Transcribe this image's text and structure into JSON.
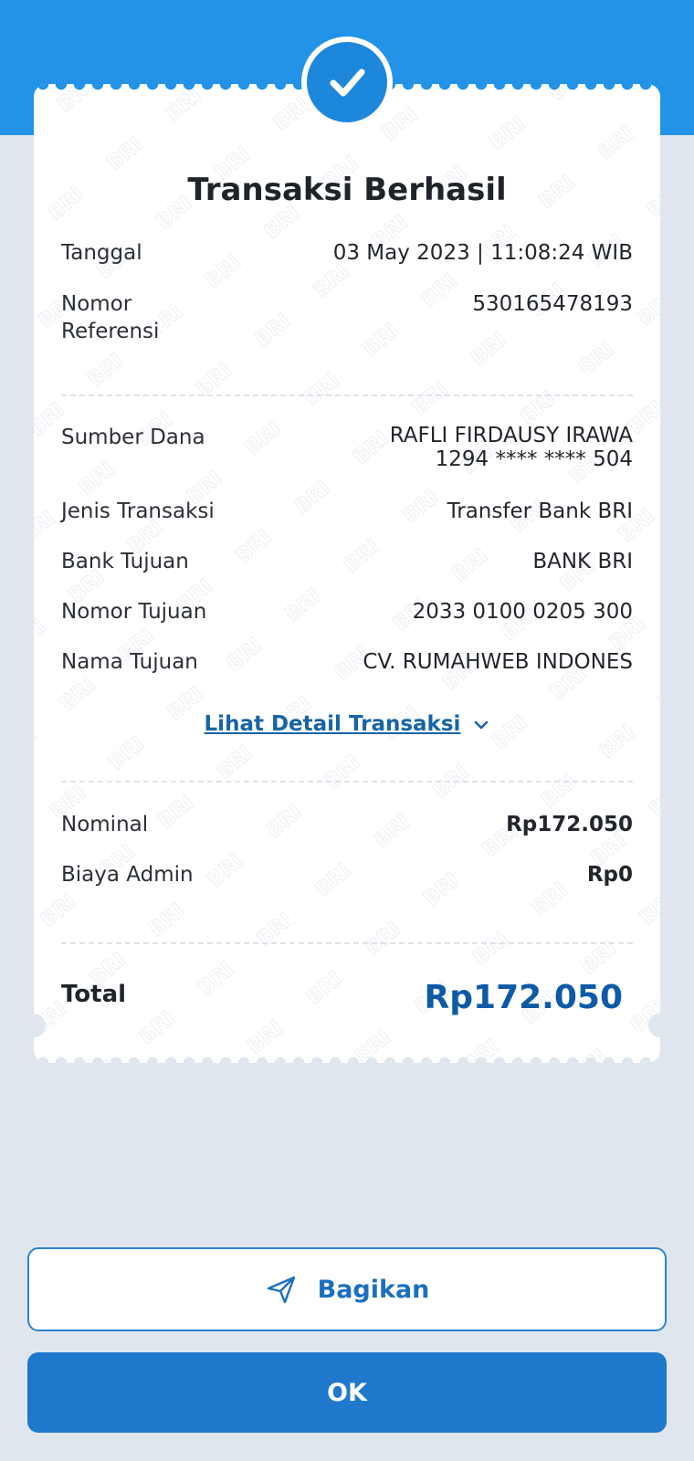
{
  "colors": {
    "header_blue": "#2293e6",
    "accent": "#1f78cc",
    "total_value": "#0e5aa7",
    "background": "#dfe6ee"
  },
  "receipt": {
    "status_icon": "check-icon",
    "title": "Transaksi Berhasil",
    "watermark_text": "BRI",
    "tanggal": {
      "label": "Tanggal",
      "value": "03 May 2023 | 11:08:24 WIB"
    },
    "nomor_referensi": {
      "label_line1": "Nomor",
      "label_line2": "Referensi",
      "value": "530165478193"
    },
    "sumber_dana": {
      "label": "Sumber Dana",
      "name": "RAFLI FIRDAUSY IRAWA",
      "account": "1294 **** **** 504"
    },
    "jenis_transaksi": {
      "label": "Jenis Transaksi",
      "value": "Transfer Bank BRI"
    },
    "bank_tujuan": {
      "label": "Bank Tujuan",
      "value": "BANK BRI"
    },
    "nomor_tujuan": {
      "label": "Nomor Tujuan",
      "value": "2033 0100 0205 300"
    },
    "nama_tujuan": {
      "label": "Nama Tujuan",
      "value": "CV. RUMAHWEB INDONES"
    },
    "detail_link": {
      "label": "Lihat Detail Transaksi",
      "icon": "chevron-down-icon"
    },
    "nominal": {
      "label": "Nominal",
      "value": "Rp172.050"
    },
    "biaya_admin": {
      "label": "Biaya Admin",
      "value": "Rp0"
    },
    "total": {
      "label": "Total",
      "value": "Rp172.050"
    }
  },
  "actions": {
    "share": {
      "label": "Bagikan",
      "icon": "send-icon"
    },
    "ok": {
      "label": "OK"
    }
  }
}
